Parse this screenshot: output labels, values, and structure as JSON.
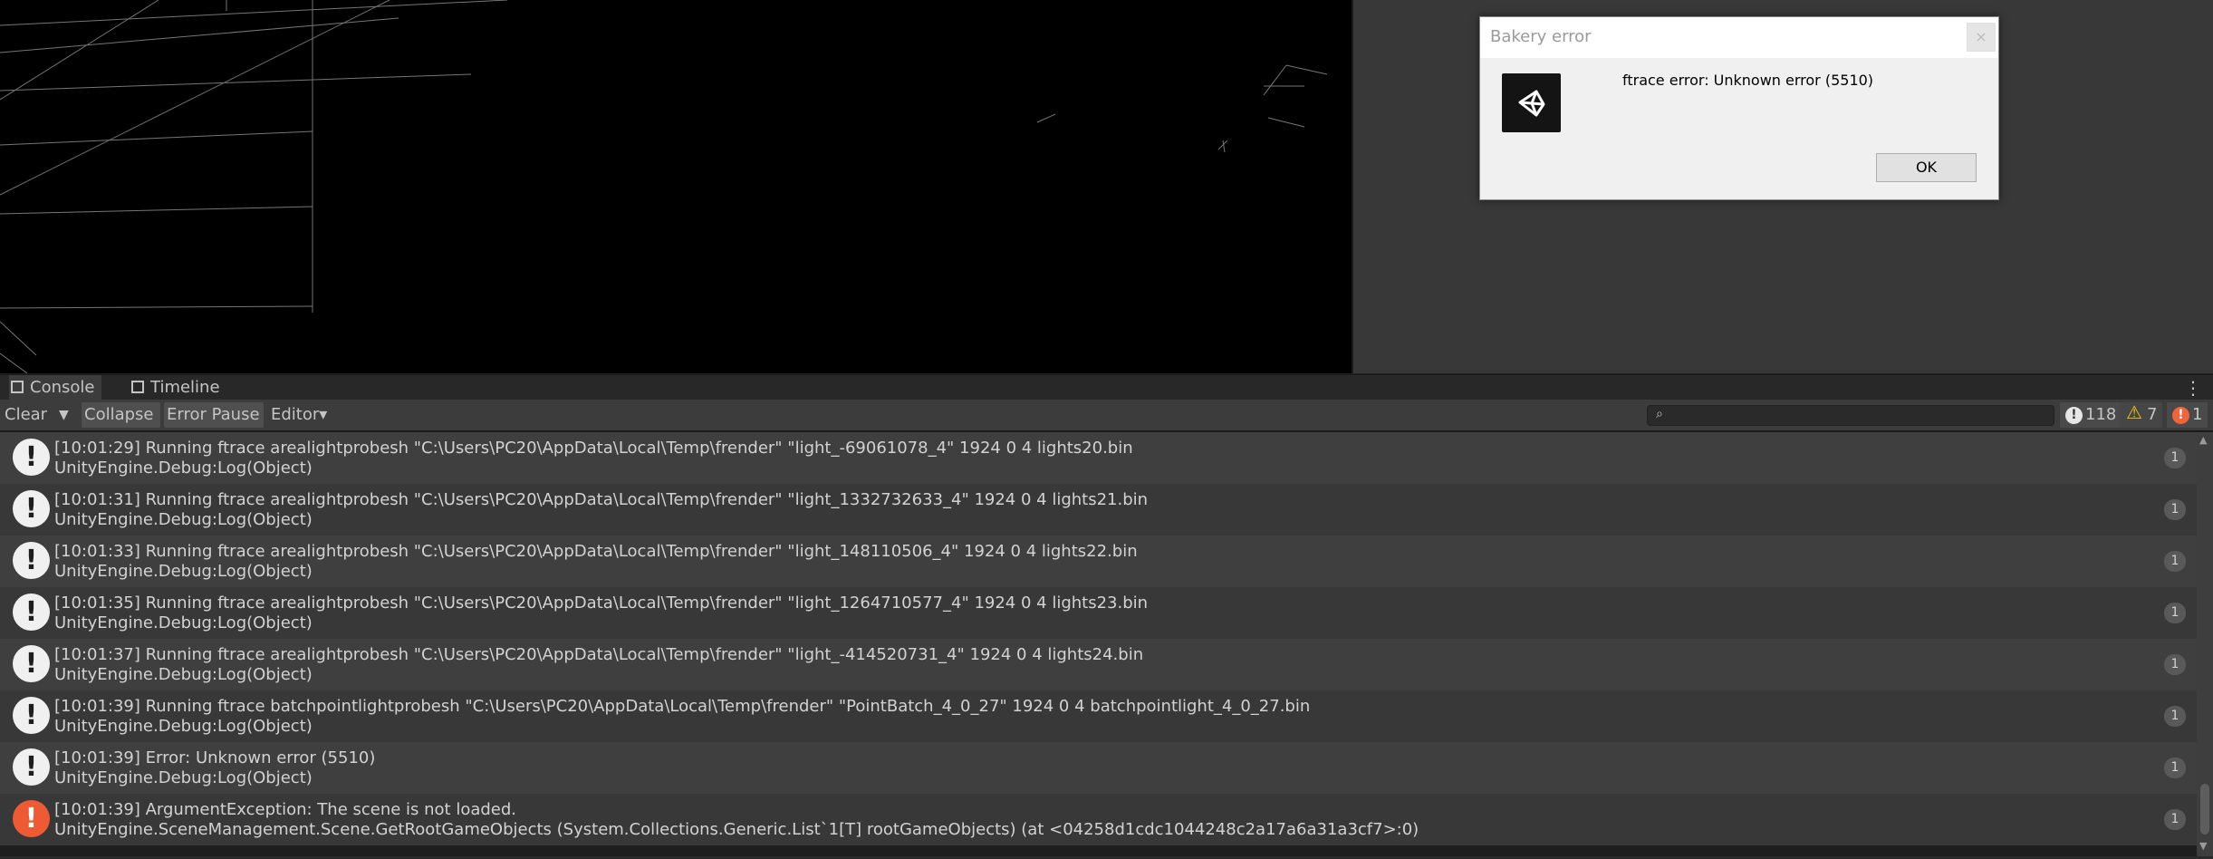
{
  "dialog": {
    "title": "Bakery error",
    "close_glyph": "×",
    "message": "ftrace error: Unknown error (5510)",
    "ok_label": "OK",
    "icon": "unity-logo-icon"
  },
  "console": {
    "tabs": [
      {
        "label": "Console",
        "icon": "console-list-icon"
      },
      {
        "label": "Timeline",
        "icon": "timeline-film-icon"
      }
    ],
    "menu_glyph": "⋮",
    "toolbar": {
      "clear_label": "Clear",
      "clear_dropdown_glyph": "▼",
      "collapse_label": "Collapse",
      "error_pause_label": "Error Pause",
      "editor_label": "Editor",
      "editor_dropdown_glyph": "▾",
      "search_icon_glyph": "🔍",
      "search_value": ""
    },
    "counters": {
      "log": "118",
      "warning": "7",
      "error": "1"
    },
    "entries": [
      {
        "type": "log",
        "line1": "[10:01:29] Running ftrace arealightprobesh \"C:\\Users\\PC20\\AppData\\Local\\Temp\\frender\" \"light_-69061078_4\" 1924 0 4 lights20.bin",
        "line2": "UnityEngine.Debug:Log(Object)",
        "count": "1"
      },
      {
        "type": "log",
        "line1": "[10:01:31] Running ftrace arealightprobesh \"C:\\Users\\PC20\\AppData\\Local\\Temp\\frender\" \"light_1332732633_4\" 1924 0 4 lights21.bin",
        "line2": "UnityEngine.Debug:Log(Object)",
        "count": "1"
      },
      {
        "type": "log",
        "line1": "[10:01:33] Running ftrace arealightprobesh \"C:\\Users\\PC20\\AppData\\Local\\Temp\\frender\" \"light_148110506_4\" 1924 0 4 lights22.bin",
        "line2": "UnityEngine.Debug:Log(Object)",
        "count": "1"
      },
      {
        "type": "log",
        "line1": "[10:01:35] Running ftrace arealightprobesh \"C:\\Users\\PC20\\AppData\\Local\\Temp\\frender\" \"light_1264710577_4\" 1924 0 4 lights23.bin",
        "line2": "UnityEngine.Debug:Log(Object)",
        "count": "1"
      },
      {
        "type": "log",
        "line1": "[10:01:37] Running ftrace arealightprobesh \"C:\\Users\\PC20\\AppData\\Local\\Temp\\frender\" \"light_-414520731_4\" 1924 0 4 lights24.bin",
        "line2": "UnityEngine.Debug:Log(Object)",
        "count": "1"
      },
      {
        "type": "log",
        "line1": "[10:01:39] Running ftrace batchpointlightprobesh \"C:\\Users\\PC20\\AppData\\Local\\Temp\\frender\" \"PointBatch_4_0_27\" 1924 0 4 batchpointlight_4_0_27.bin",
        "line2": "UnityEngine.Debug:Log(Object)",
        "count": "1"
      },
      {
        "type": "log",
        "line1": "[10:01:39] Error: Unknown error (5510)",
        "line2": "UnityEngine.Debug:Log(Object)",
        "count": "1"
      },
      {
        "type": "error",
        "line1": "[10:01:39] ArgumentException: The scene is not loaded.",
        "line2": "UnityEngine.SceneManagement.Scene.GetRootGameObjects (System.Collections.Generic.List`1[T] rootGameObjects) (at <04258d1cdc1044248c2a17a6a31a3cf7>:0)",
        "count": "1"
      }
    ],
    "log_icon_glyph": "!",
    "scroll_up_glyph": "▲",
    "scroll_down_glyph": "▼"
  }
}
